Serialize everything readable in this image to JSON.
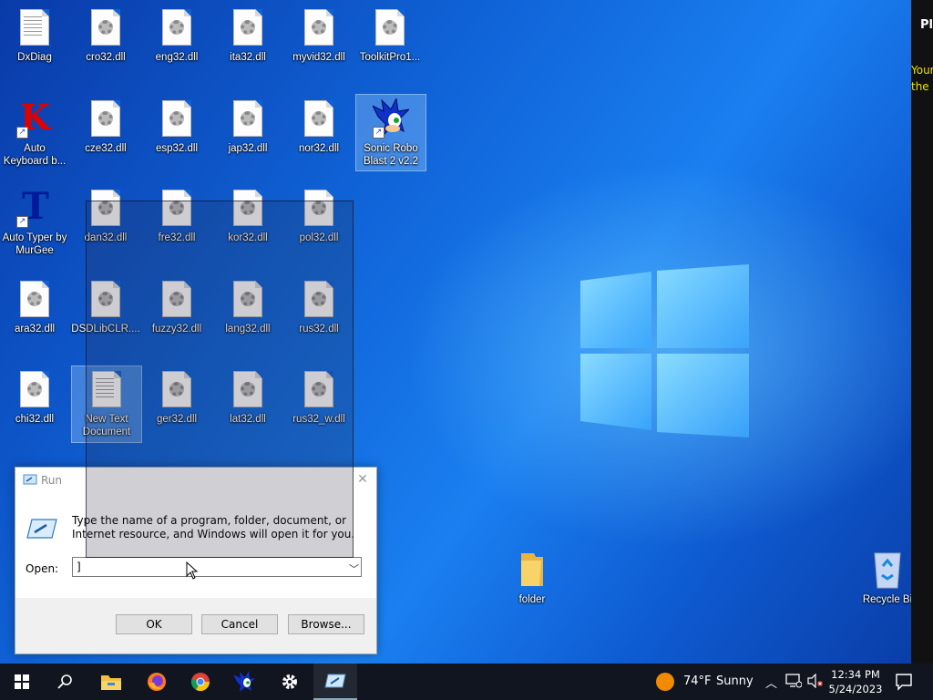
{
  "desktop": {
    "icons": [
      {
        "label": "DxDiag",
        "kind": "text-doc"
      },
      {
        "label": "cro32.dll",
        "kind": "dll"
      },
      {
        "label": "eng32.dll",
        "kind": "dll"
      },
      {
        "label": "ita32.dll",
        "kind": "dll"
      },
      {
        "label": "myvid32.dll",
        "kind": "dll"
      },
      {
        "label": "ToolkitPro1...",
        "kind": "dll"
      },
      {
        "label": "Auto Keyboard b...",
        "kind": "app-k"
      },
      {
        "label": "cze32.dll",
        "kind": "dll"
      },
      {
        "label": "esp32.dll",
        "kind": "dll"
      },
      {
        "label": "jap32.dll",
        "kind": "dll"
      },
      {
        "label": "nor32.dll",
        "kind": "dll"
      },
      {
        "label": "Sonic Robo Blast 2 v2.2",
        "kind": "app-sonic"
      },
      {
        "label": "Auto Typer by MurGee",
        "kind": "app-t"
      },
      {
        "label": "dan32.dll",
        "kind": "dll"
      },
      {
        "label": "fre32.dll",
        "kind": "dll"
      },
      {
        "label": "kor32.dll",
        "kind": "dll"
      },
      {
        "label": "pol32.dll",
        "kind": "dll"
      },
      {
        "label": "ara32.dll",
        "kind": "dll"
      },
      {
        "label": "DSDLibCLR....",
        "kind": "dll"
      },
      {
        "label": "fuzzy32.dll",
        "kind": "dll"
      },
      {
        "label": "lang32.dll",
        "kind": "dll"
      },
      {
        "label": "rus32.dll",
        "kind": "dll"
      },
      {
        "label": "chi32.dll",
        "kind": "dll"
      },
      {
        "label": "New Text Document",
        "kind": "text-doc"
      },
      {
        "label": "ger32.dll",
        "kind": "dll"
      },
      {
        "label": "lat32.dll",
        "kind": "dll"
      },
      {
        "label": "rus32_w.dll",
        "kind": "dll"
      },
      {
        "label": "folder",
        "kind": "folder"
      },
      {
        "label": "Recycle Bi",
        "kind": "recycle"
      }
    ]
  },
  "right_panel": {
    "title": "Pl",
    "line1": "Your",
    "line2": "the"
  },
  "run_dialog": {
    "title": "Run",
    "close": "✕",
    "description": "Type the name of a program, folder, document, or Internet resource, and Windows will open it for you.",
    "open_label": "Open:",
    "open_value": "]",
    "ok": "OK",
    "cancel": "Cancel",
    "browse": "Browse..."
  },
  "taskbar": {
    "temperature": "74°F",
    "weather": "Sunny",
    "time": "12:34 PM",
    "date": "5/24/2023",
    "icons": [
      "windows-start-icon",
      "search-icon",
      "file-explorer-icon",
      "firefox-icon",
      "chrome-icon",
      "sonic-icon",
      "settings-icon",
      "run-icon"
    ]
  },
  "colors": {
    "accent": "#0f62d6",
    "taskbar": "#101520",
    "panel_text": "#e8e000"
  }
}
